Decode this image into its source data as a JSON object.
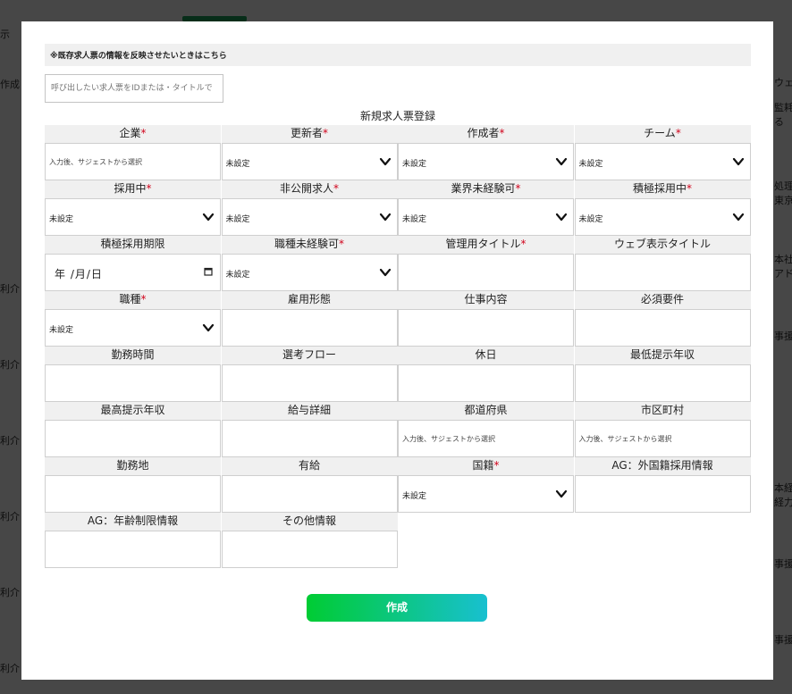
{
  "background": {
    "left_texts": [
      "示",
      "作成",
      "利介",
      "利介",
      "利介",
      "利介",
      "利介",
      "利介"
    ],
    "right_texts": [
      "ウェ",
      "監耗",
      "る",
      "処理",
      "東京",
      "本社",
      "アド",
      "事援",
      "本経",
      "経力",
      "事援",
      "事援"
    ]
  },
  "modal": {
    "notice": "※既存求人票の情報を反映させたいときはこちら",
    "recall_placeholder": "呼び出したい求人票をIDまたは・タイトルで",
    "form_title": "新規求人票登録",
    "submit_label": "作成"
  },
  "fields": [
    {
      "label": "企業",
      "required": true,
      "type": "text",
      "placeholder": "入力後、サジェストから選択"
    },
    {
      "label": "更新者",
      "required": true,
      "type": "select",
      "value": "未設定"
    },
    {
      "label": "作成者",
      "required": true,
      "type": "select",
      "value": "未設定"
    },
    {
      "label": "チーム",
      "required": true,
      "type": "select",
      "value": "未設定"
    },
    {
      "label": "採用中",
      "required": true,
      "type": "select",
      "value": "未設定"
    },
    {
      "label": "非公開求人",
      "required": true,
      "type": "select",
      "value": "未設定"
    },
    {
      "label": "業界未経験可",
      "required": true,
      "type": "select",
      "value": "未設定"
    },
    {
      "label": "積極採用中",
      "required": true,
      "type": "select",
      "value": "未設定"
    },
    {
      "label": "積極採用期限",
      "required": false,
      "type": "date",
      "value": "年 /月/日"
    },
    {
      "label": "職種未経験可",
      "required": true,
      "type": "select",
      "value": "未設定"
    },
    {
      "label": "管理用タイトル",
      "required": true,
      "type": "text"
    },
    {
      "label": "ウェブ表示タイトル",
      "required": false,
      "type": "text"
    },
    {
      "label": "職種",
      "required": true,
      "type": "select",
      "value": "未設定"
    },
    {
      "label": "雇用形態",
      "required": false,
      "type": "text"
    },
    {
      "label": "仕事内容",
      "required": false,
      "type": "text"
    },
    {
      "label": "必須要件",
      "required": false,
      "type": "text"
    },
    {
      "label": "勤務時間",
      "required": false,
      "type": "text"
    },
    {
      "label": "選考フロー",
      "required": false,
      "type": "text"
    },
    {
      "label": "休日",
      "required": false,
      "type": "text"
    },
    {
      "label": "最低提示年収",
      "required": false,
      "type": "text"
    },
    {
      "label": "最高提示年収",
      "required": false,
      "type": "text"
    },
    {
      "label": "給与詳細",
      "required": false,
      "type": "text"
    },
    {
      "label": "都道府県",
      "required": false,
      "type": "text",
      "placeholder": "入力後、サジェストから選択"
    },
    {
      "label": "市区町村",
      "required": false,
      "type": "text",
      "placeholder": "入力後、サジェストから選択"
    },
    {
      "label": "勤務地",
      "required": false,
      "type": "text"
    },
    {
      "label": "有給",
      "required": false,
      "type": "text"
    },
    {
      "label": "国籍",
      "required": true,
      "type": "select",
      "value": "未設定"
    },
    {
      "label": "AG：外国籍採用情報",
      "required": false,
      "type": "text"
    },
    {
      "label": "AG：年齢制限情報",
      "required": false,
      "type": "text"
    },
    {
      "label": "その他情報",
      "required": false,
      "type": "text"
    }
  ],
  "required_mark": "*",
  "icons": {
    "select": "chevron-down-icon",
    "date": "calendar-icon"
  },
  "colors": {
    "required": "#d0021b",
    "button_start": "#00cc33",
    "button_end": "#18c0d0",
    "label_bg": "#f0f0f0"
  }
}
